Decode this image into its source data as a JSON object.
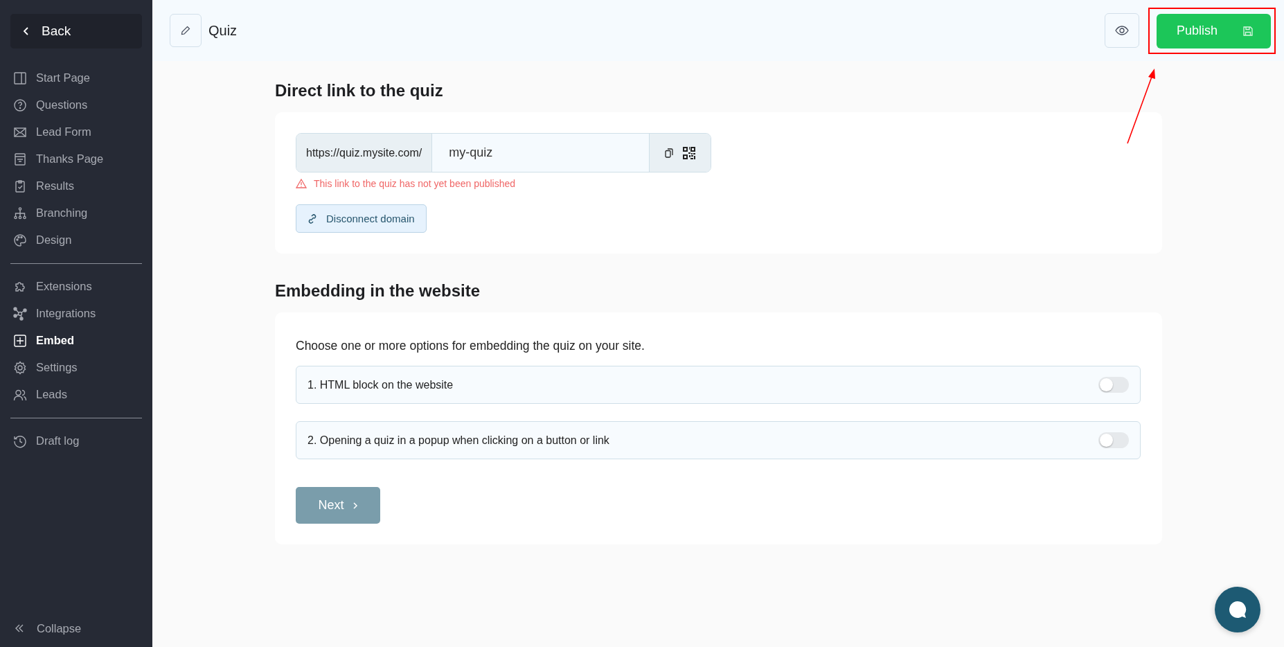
{
  "sidebar": {
    "back": "Back",
    "groups": [
      [
        {
          "label": "Start Page",
          "selected": false
        },
        {
          "label": "Questions",
          "selected": false
        },
        {
          "label": "Lead Form",
          "selected": false
        },
        {
          "label": "Thanks Page",
          "selected": false
        },
        {
          "label": "Results",
          "selected": false
        },
        {
          "label": "Branching",
          "selected": false
        },
        {
          "label": "Design",
          "selected": false
        }
      ],
      [
        {
          "label": "Extensions",
          "selected": false
        },
        {
          "label": "Integrations",
          "selected": false
        },
        {
          "label": "Embed",
          "selected": true
        },
        {
          "label": "Settings",
          "selected": false
        },
        {
          "label": "Leads",
          "selected": false
        }
      ],
      [
        {
          "label": "Draft log",
          "selected": false
        }
      ]
    ],
    "collapse": "Collapse"
  },
  "header": {
    "title": "Quiz",
    "publish": "Publish"
  },
  "direct_link": {
    "heading": "Direct link to the quiz",
    "prefix": "https://quiz.mysite.com/",
    "slug": "my-quiz",
    "warning": "This link to the quiz has not yet been published",
    "disconnect": "Disconnect domain"
  },
  "embedding": {
    "heading": "Embedding in the website",
    "intro": "Choose one or more options for embedding the quiz on your site.",
    "options": [
      {
        "label": "1. HTML block on the website",
        "on": false
      },
      {
        "label": "2. Opening a quiz in a popup when clicking on a button or link",
        "on": false
      }
    ],
    "next": "Next"
  }
}
